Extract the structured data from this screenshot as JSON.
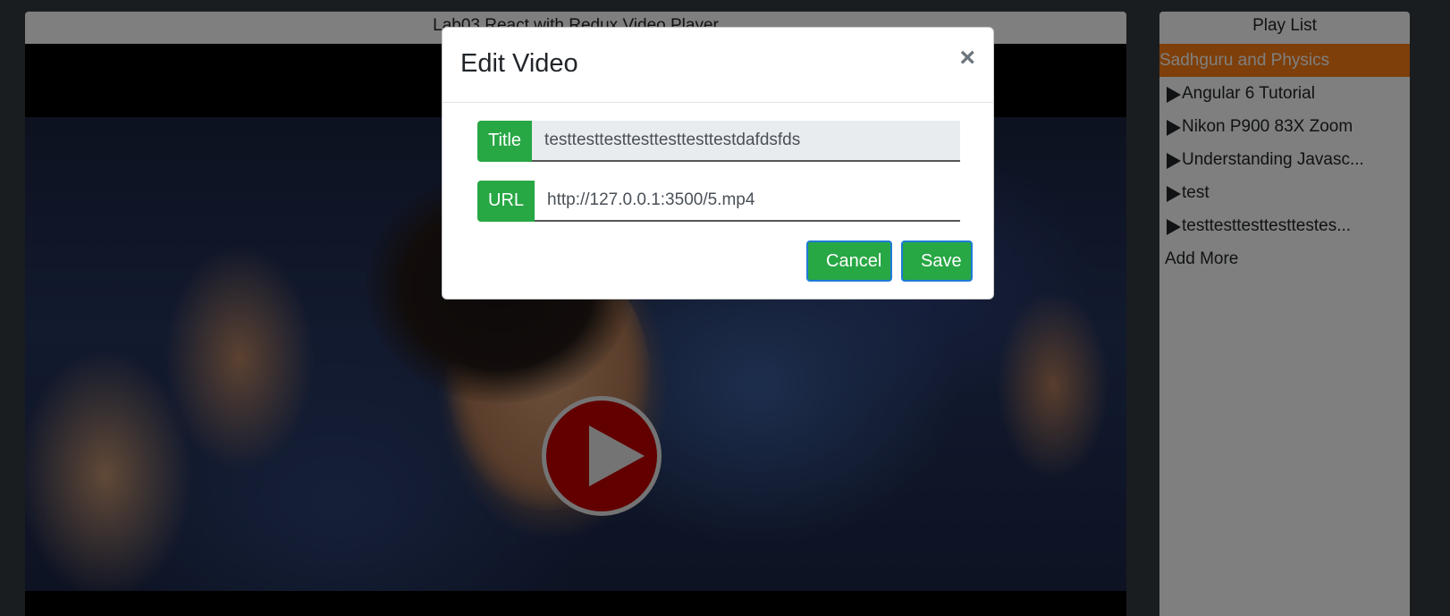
{
  "player": {
    "header_title": "Lab03 React with Redux Video Player"
  },
  "playlist": {
    "header_title": "Play List",
    "items": [
      {
        "label": "Sadhguru and Physics",
        "active": true
      },
      {
        "label": "Angular 6 Tutorial",
        "active": false
      },
      {
        "label": "Nikon P900 83X Zoom",
        "active": false
      },
      {
        "label": "Understanding Javasc...",
        "active": false
      },
      {
        "label": "test",
        "active": false
      },
      {
        "label": "testtesttesttesttestes...",
        "active": false
      }
    ],
    "add_more_label": "Add More"
  },
  "modal": {
    "title": "Edit Video",
    "close_symbol": "×",
    "title_addon": "Title",
    "title_value": "testtesttesttesttesttesttestdafdsfds",
    "url_addon": "URL",
    "url_value": "http://127.0.0.1:3500/5.mp4",
    "cancel_label": "Cancel",
    "save_label": "Save"
  },
  "icons": {
    "play": "play-icon",
    "playlist_item": "play-triangle-icon",
    "close": "close-icon"
  },
  "colors": {
    "accent_green": "#28a745",
    "active_item": "#fd7e14",
    "play_button": "#c40000"
  }
}
